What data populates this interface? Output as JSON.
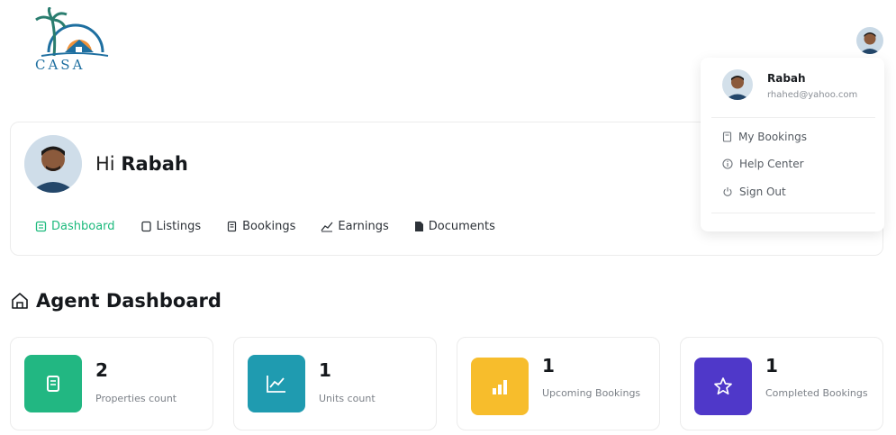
{
  "brand": {
    "logo_text": "CASA"
  },
  "user": {
    "name": "Rabah",
    "email": "rhahed@yahoo.com"
  },
  "profile": {
    "greeting_prefix": "Hi",
    "name": "Rabah"
  },
  "nav": {
    "dashboard": "Dashboard",
    "listings": "Listings",
    "bookings": "Bookings",
    "earnings": "Earnings",
    "documents": "Documents"
  },
  "dropdown": {
    "name": "Rabah",
    "email": "rhahed@yahoo.com",
    "items": [
      "My Bookings",
      "Help Center",
      "Sign Out"
    ]
  },
  "section": {
    "title": "Agent Dashboard"
  },
  "stats": [
    {
      "value": "2",
      "label": "Properties count",
      "color": "#22b782",
      "icon": "document-icon"
    },
    {
      "value": "1",
      "label": "Units count",
      "color": "#1f9bb0",
      "icon": "trend-chart-icon"
    },
    {
      "value": "1",
      "label": "Upcoming Bookings",
      "color": "#f7bd2c",
      "icon": "bar-chart-icon"
    },
    {
      "value": "1",
      "label": "Completed Bookings",
      "color": "#4f38c9",
      "icon": "star-icon"
    }
  ],
  "colors": {
    "accent": "#1dba7d"
  }
}
